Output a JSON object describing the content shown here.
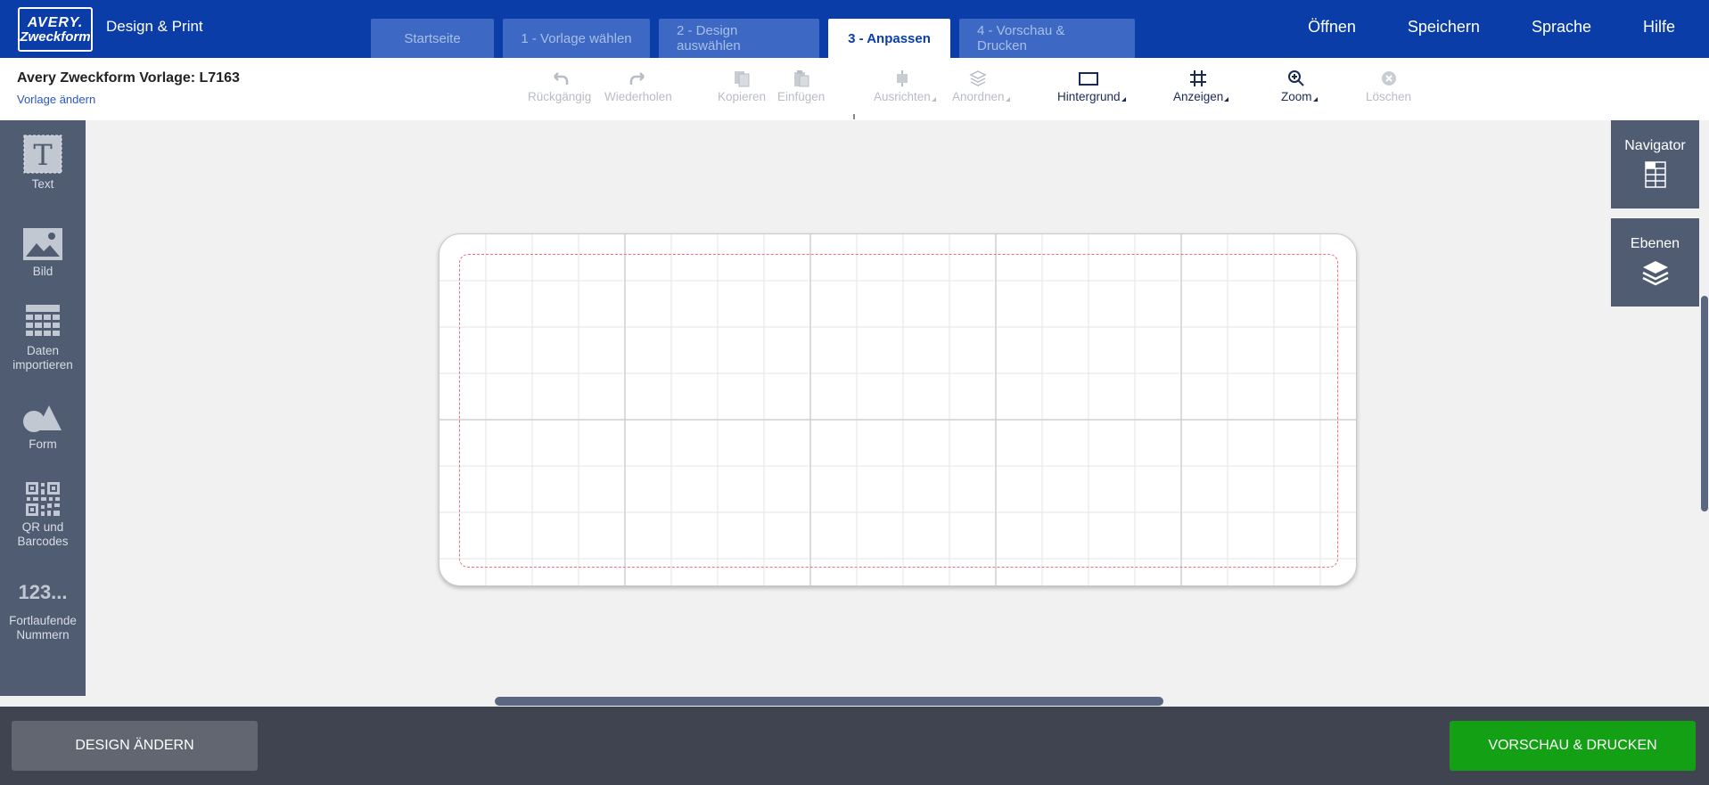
{
  "header": {
    "logo_line1": "AVERY.",
    "logo_line2": "Zweckform",
    "app_name": "Design & Print",
    "steps": [
      {
        "label": "Startseite",
        "active": false
      },
      {
        "label": "1 - Vorlage wählen",
        "active": false
      },
      {
        "label": "2 - Design auswählen",
        "active": false
      },
      {
        "label": "3 - Anpassen",
        "active": true
      },
      {
        "label": "4 - Vorschau & Drucken",
        "active": false
      }
    ],
    "nav": [
      "Öffnen",
      "Speichern",
      "Sprache",
      "Hilfe"
    ]
  },
  "toolbar": {
    "template_title": "Avery Zweckform Vorlage: L7163",
    "change_template": "Vorlage ändern",
    "tools": [
      {
        "label": "Rückgängig",
        "icon": "undo-icon",
        "enabled": false
      },
      {
        "label": "Wiederholen",
        "icon": "redo-icon",
        "enabled": false
      },
      {
        "label": "Kopieren",
        "icon": "copy-icon",
        "enabled": false
      },
      {
        "label": "Einfügen",
        "icon": "paste-icon",
        "enabled": false
      },
      {
        "label": "Ausrichten",
        "icon": "align-icon",
        "enabled": false
      },
      {
        "label": "Anordnen",
        "icon": "arrange-icon",
        "enabled": false
      },
      {
        "label": "Hintergrund",
        "icon": "background-icon",
        "enabled": true
      },
      {
        "label": "Anzeigen",
        "icon": "grid-icon",
        "enabled": true
      },
      {
        "label": "Zoom",
        "icon": "zoom-icon",
        "enabled": true
      },
      {
        "label": "Löschen",
        "icon": "delete-icon",
        "enabled": false
      }
    ]
  },
  "sidebar": {
    "items": [
      {
        "label": "Text",
        "icon": "text-icon"
      },
      {
        "label": "Bild",
        "icon": "image-icon"
      },
      {
        "label": "Daten importieren",
        "icon": "data-import-icon"
      },
      {
        "label": "Form",
        "icon": "shape-icon"
      },
      {
        "label": "QR und Barcodes",
        "icon": "qr-code-icon"
      },
      {
        "label": "Fortlaufende Nummern",
        "icon": "numbering-icon",
        "glyph": "123..."
      }
    ]
  },
  "right_panels": {
    "navigator": "Navigator",
    "layers": "Ebenen"
  },
  "footer": {
    "change_design": "DESIGN ÄNDERN",
    "preview_print": "VORSCHAU & DRUCKEN"
  },
  "colors": {
    "header_blue": "#0a3da8",
    "sidebar": "#4f5c72",
    "print_button": "#14a014",
    "safe_area_dashed": "#ee6f82"
  }
}
